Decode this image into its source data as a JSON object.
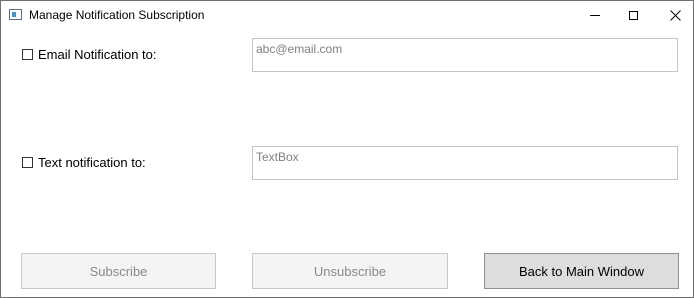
{
  "window": {
    "title": "Manage Notification Subscription",
    "controls": {
      "minimize": "minimize-icon",
      "maximize": "maximize-icon",
      "close_glyph": "✕"
    }
  },
  "form": {
    "email": {
      "label": "Email Notification to:",
      "checked": false,
      "value": "abc@email.com"
    },
    "text": {
      "label": "Text notification to:",
      "checked": false,
      "value": "TextBox"
    }
  },
  "buttons": {
    "subscribe": "Subscribe",
    "unsubscribe": "Unsubscribe",
    "back": "Back to Main Window"
  },
  "colors": {
    "disabled_text": "#8a8a8a",
    "button_face": "#dddddd",
    "placeholder_text": "#808080"
  }
}
